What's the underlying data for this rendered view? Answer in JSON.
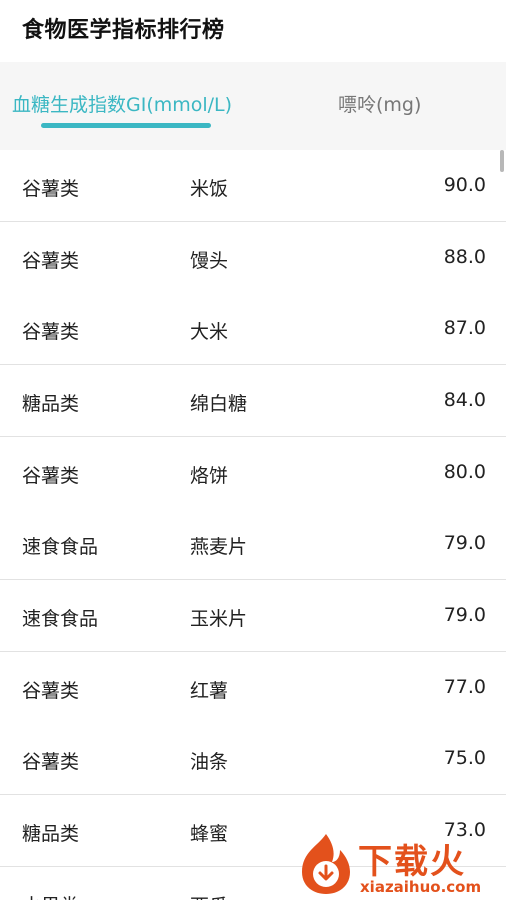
{
  "header": {
    "title": "食物医学指标排行榜"
  },
  "tabs": [
    {
      "label": "血糖生成指数GI(mmol/L)",
      "active": true
    },
    {
      "label": "嘌呤(mg)",
      "active": false
    }
  ],
  "accent_color": "#3bb7c3",
  "list": {
    "rows": [
      {
        "category": "谷薯类",
        "food": "米饭",
        "value": "90.0"
      },
      {
        "category": "谷薯类",
        "food": "馒头",
        "value": "88.0"
      },
      {
        "category": "谷薯类",
        "food": "大米",
        "value": "87.0"
      },
      {
        "category": "糖品类",
        "food": "绵白糖",
        "value": "84.0"
      },
      {
        "category": "谷薯类",
        "food": "烙饼",
        "value": "80.0"
      },
      {
        "category": "速食食品",
        "food": "燕麦片",
        "value": "79.0"
      },
      {
        "category": "速食食品",
        "food": "玉米片",
        "value": "79.0"
      },
      {
        "category": "谷薯类",
        "food": "红薯",
        "value": "77.0"
      },
      {
        "category": "谷薯类",
        "food": "油条",
        "value": "75.0"
      },
      {
        "category": "糖品类",
        "food": "蜂蜜",
        "value": "73.0"
      },
      {
        "category": "水果类",
        "food": "西瓜",
        "value": ""
      }
    ]
  },
  "watermark": {
    "brand": "下载火",
    "url": "xiazaihuo.com"
  }
}
